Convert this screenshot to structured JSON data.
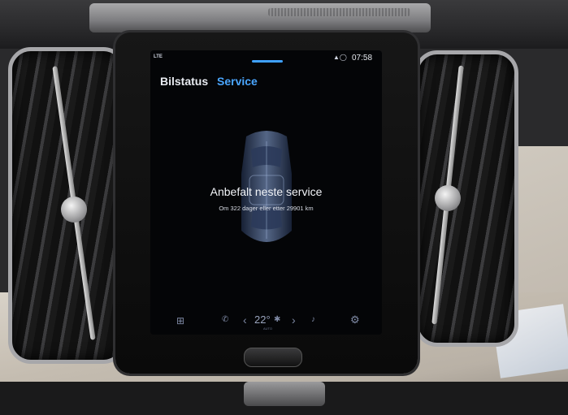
{
  "screen": {
    "status_bar": {
      "signal": "LTE",
      "icons": "▲◯",
      "time": "07:58"
    },
    "tabs": [
      {
        "label": "Bilstatus",
        "active": false
      },
      {
        "label": "Service",
        "active": true
      }
    ],
    "service": {
      "title": "Anbefalt neste service",
      "detail": "Om 322 dager eller etter 29901 km"
    },
    "climate_bar": {
      "temperature": "22°",
      "auto_label": "AUTO"
    }
  },
  "icons": [
    "apps-icon",
    "phone-icon",
    "chevron-left-icon",
    "fan-icon",
    "chevron-right-icon",
    "seat-icon",
    "settings-icon"
  ],
  "colors": {
    "accent": "#4aa6ff",
    "screen_bg": "#040507"
  }
}
